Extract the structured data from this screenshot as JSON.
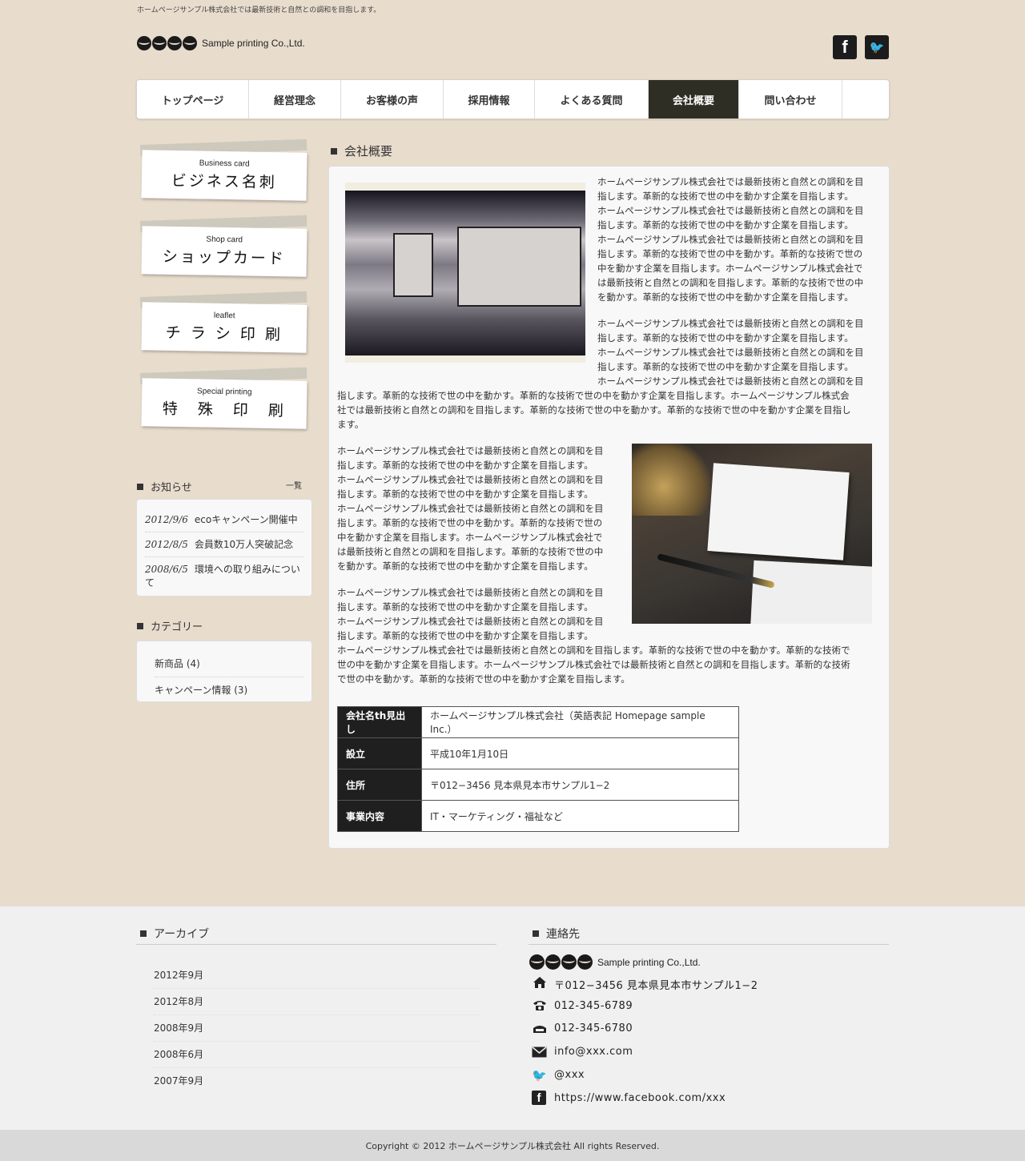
{
  "header": {
    "tagline": "ホームページサンプル株式会社では最新技術と自然との調和を目指します。",
    "company_name": "Sample printing  Co.,Ltd.",
    "facebook_glyph": "f",
    "twitter_glyph": "🐦"
  },
  "nav": {
    "items": [
      "トップページ",
      "経営理念",
      "お客様の声",
      "採用情報",
      "よくある質問",
      "会社概要",
      "問い合わせ"
    ],
    "active": "会社概要"
  },
  "sidebar": {
    "cards": [
      {
        "en": "Business card",
        "jp": "ビジネス名刺"
      },
      {
        "en": "Shop card",
        "jp": "ショップカード"
      },
      {
        "en": "leaflet",
        "jp": "チ ラ シ 印 刷"
      },
      {
        "en": "Special printing",
        "jp": "特　殊　印　刷"
      }
    ],
    "news_title": "お知らせ",
    "news_more": "一覧",
    "news": [
      {
        "date": "2012/9/6",
        "text": "ecoキャンペーン開催中"
      },
      {
        "date": "2012/8/5",
        "text": "会員数10万人突破記念"
      },
      {
        "date": "2008/6/5",
        "text": "環境への取り組みについて"
      }
    ],
    "category_title": "カテゴリー",
    "categories": [
      "新商品 (4)",
      "キャンペーン情報 (3)"
    ]
  },
  "main": {
    "title": "会社概要",
    "p1_right": [
      "ホームページサンプル株式会社では最新技術と自然との調和を目",
      "指します。革新的な技術で世の中を動かす企業を目指します。",
      "ホームページサンプル株式会社では最新技術と自然との調和を目",
      "指します。革新的な技術で世の中を動かす企業を目指します。",
      "ホームページサンプル株式会社では最新技術と自然との調和を目",
      "指します。革新的な技術で世の中を動かす。革新的な技術で世の",
      "中を動かす企業を目指します。ホームページサンプル株式会社で",
      "は最新技術と自然との調和を目指します。革新的な技術で世の中",
      "を動かす。革新的な技術で世の中を動かす企業を目指します。"
    ],
    "p2_right": [
      "ホームページサンプル株式会社では最新技術と自然との調和を目",
      "指します。革新的な技術で世の中を動かす企業を目指します。",
      "ホームページサンプル株式会社では最新技術と自然との調和を目",
      "指します。革新的な技術で世の中を動かす企業を目指します。",
      "ホームページサンプル株式会社では最新技術と自然との調和を目"
    ],
    "p2_full": [
      "指します。革新的な技術で世の中を動かす。革新的な技術で世の中を動かす企業を目指します。ホームページサンプル株式会",
      "社では最新技術と自然との調和を目指します。革新的な技術で世の中を動かす。革新的な技術で世の中を動かす企業を目指し",
      "ます。"
    ],
    "p3_left": [
      "ホームページサンプル株式会社では最新技術と自然との調和を目",
      "指します。革新的な技術で世の中を動かす企業を目指します。",
      "ホームページサンプル株式会社では最新技術と自然との調和を目",
      "指します。革新的な技術で世の中を動かす企業を目指します。",
      "ホームページサンプル株式会社では最新技術と自然との調和を目",
      "指します。革新的な技術で世の中を動かす。革新的な技術で世の",
      "中を動かす企業を目指します。ホームページサンプル株式会社で",
      "は最新技術と自然との調和を目指します。革新的な技術で世の中",
      "を動かす。革新的な技術で世の中を動かす企業を目指します。"
    ],
    "p4_left": [
      "ホームページサンプル株式会社では最新技術と自然との調和を目",
      "指します。革新的な技術で世の中を動かす企業を目指します。",
      "ホームページサンプル株式会社では最新技術と自然との調和を目",
      "指します。革新的な技術で世の中を動かす企業を目指します。"
    ],
    "p4_full": [
      "ホームページサンプル株式会社では最新技術と自然との調和を目指します。革新的な技術で世の中を動かす。革新的な技術で",
      "世の中を動かす企業を目指します。ホームページサンプル株式会社では最新技術と自然との調和を目指します。革新的な技術",
      "で世の中を動かす。革新的な技術で世の中を動かす企業を目指します。"
    ],
    "table": [
      {
        "th": "会社名th見出し",
        "td": "ホームページサンプル株式会社（英語表記 Homepage sample Inc.）"
      },
      {
        "th": "設立",
        "td": "平成10年1月10日"
      },
      {
        "th": "住所",
        "td": "〒012−3456 見本県見本市サンプル1−2"
      },
      {
        "th": "事業内容",
        "td": "IT・マーケティング・福祉など"
      }
    ]
  },
  "footer": {
    "archive_title": "アーカイブ",
    "archives": [
      "2012年9月",
      "2012年8月",
      "2008年9月",
      "2008年6月",
      "2007年9月"
    ],
    "contact_title": "連絡先",
    "company_name": "Sample printing  Co.,Ltd.",
    "address": "〒012−3456 見本県見本市サンプル1−2",
    "tel": "012-345-6789",
    "fax": "012-345-6780",
    "email": "info@xxx.com",
    "twitter": "@xxx",
    "facebook": "https://www.facebook.com/xxx",
    "copyright": "Copyright © 2012 ホームページサンプル株式会社 All rights Reserved."
  }
}
